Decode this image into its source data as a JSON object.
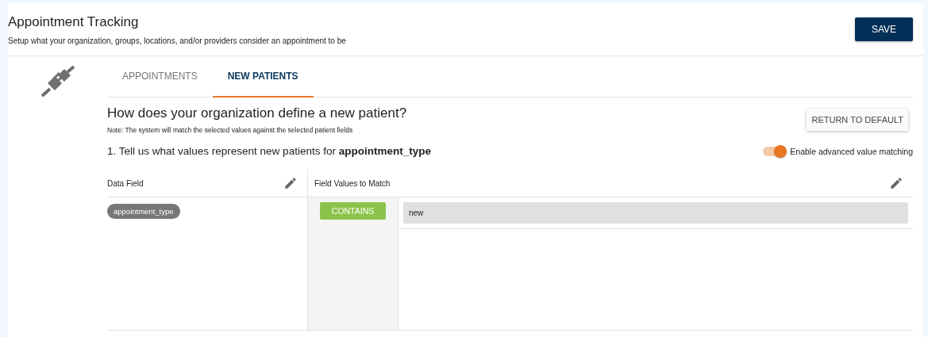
{
  "header": {
    "title": "Appointment Tracking",
    "subtitle": "Setup what your organization, groups, locations, and/or providers consider an appointment to be",
    "save_button": "SAVE"
  },
  "tabs": [
    {
      "label": "APPOINTMENTS",
      "selected": false
    },
    {
      "label": "NEW PATIENTS",
      "selected": true
    }
  ],
  "section": {
    "heading": "How does your organization define a new patient?",
    "note": "Note: The system will match the selected values against the selected patient fields",
    "return_button": "RETURN TO DEFAULT",
    "step": "1. Tell us what values represent new patients for **appointment_type**",
    "toggle": {
      "label": "Enable advanced value matching",
      "on": true
    }
  },
  "table": {
    "columns": [
      "Data Field",
      "Field Values to Match"
    ],
    "rows": [
      {
        "data_field": "appointment_type",
        "operator": "CONTAINS",
        "value": "new"
      }
    ]
  }
}
